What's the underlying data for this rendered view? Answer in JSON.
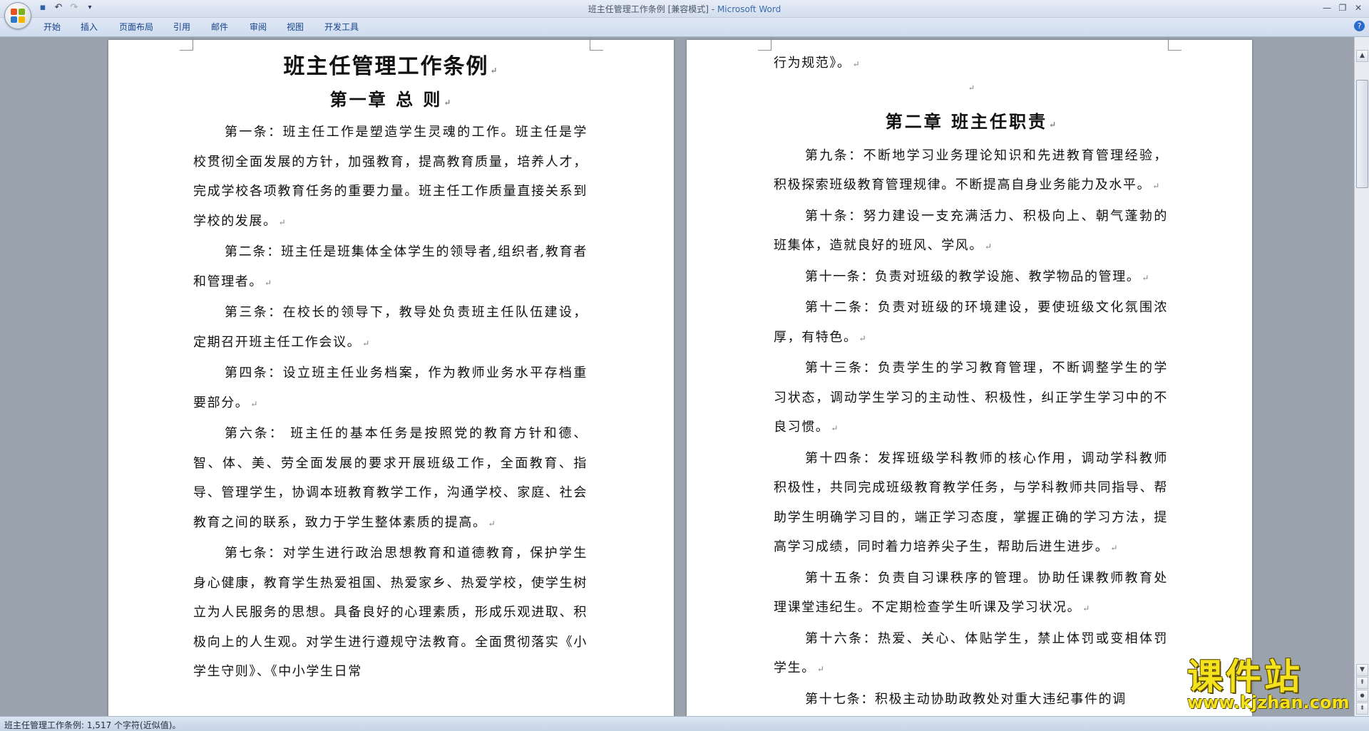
{
  "window": {
    "title_doc": "班主任管理工作条例 [兼容模式]",
    "title_sep": " - ",
    "title_app": "Microsoft Word"
  },
  "qat": {
    "save_icon": "▪",
    "undo_icon": "↶",
    "redo_icon": "↷",
    "more_icon": "▾"
  },
  "window_controls": {
    "minimize": "—",
    "restore": "❐",
    "close": "✕"
  },
  "ribbon_tabs": [
    "开始",
    "插入",
    "页面布局",
    "引用",
    "邮件",
    "审阅",
    "视图",
    "开发工具"
  ],
  "help_icon": "?",
  "para_mark": "↵",
  "page1": {
    "title": "班主任管理工作条例",
    "chapter": "第一章  总  则",
    "paragraphs": [
      "第一条：班主任工作是塑造学生灵魂的工作。班主任是学校贯彻全面发展的方针，加强教育，提高教育质量，培养人才，完成学校各项教育任务的重要力量。班主任工作质量直接关系到学校的发展。",
      "第二条：班主任是班集体全体学生的领导者,组织者,教育者和管理者。",
      "第三条：在校长的领导下，教导处负责班主任队伍建设，定期召开班主任工作会议。",
      "第四条：设立班主任业务档案，作为教师业务水平存档重要部分。",
      "第六条： 班主任的基本任务是按照党的教育方针和德、智、体、美、劳全面发展的要求开展班级工作，全面教育、指导、管理学生，协调本班教育教学工作，沟通学校、家庭、社会教育之间的联系，致力于学生整体素质的提高。",
      "第七条：对学生进行政治思想教育和道德教育，保护学生身心健康，教育学生热爱祖国、热爱家乡、热爱学校，使学生树立为人民服务的思想。具备良好的心理素质，形成乐观进取、积极向上的人生观。对学生进行遵规守法教育。全面贯彻落实《小学生守则》、《中小学生日常"
    ]
  },
  "page2": {
    "continuation": "行为规范》。",
    "chapter": "第二章    班主任职责",
    "paragraphs": [
      "第九条：不断地学习业务理论知识和先进教育管理经验，积极探索班级教育管理规律。不断提高自身业务能力及水平。",
      "第十条：努力建设一支充满活力、积极向上、朝气蓬勃的班集体，造就良好的班风、学风。",
      "第十一条：负责对班级的教学设施、教学物品的管理。",
      "第十二条：负责对班级的环境建设，要使班级文化氛围浓厚，有特色。",
      "第十三条：负责学生的学习教育管理，不断调整学生的学习状态，调动学生学习的主动性、积极性，纠正学生学习中的不良习惯。",
      "第十四条：发挥班级学科教师的核心作用，调动学科教师积极性，共同完成班级教育教学任务，与学科教师共同指导、帮助学生明确学习目的，端正学习态度，掌握正确的学习方法，提高学习成绩，同时着力培养尖子生，帮助后进生进步。",
      "第十五条：负责自习课秩序的管理。协助任课教师教育处理课堂违纪生。不定期检查学生听课及学习状况。",
      "第十六条：热爱、关心、体贴学生，禁止体罚或变相体罚学生。",
      "第十七条：积极主动协助政教处对重大违纪事件的调"
    ]
  },
  "statusbar": {
    "text": "班主任管理工作条例: 1,517 个字符(近似值)。"
  },
  "watermark": {
    "main": "课件站",
    "url": "www.kjzhan.com"
  },
  "scrollbar": {
    "up_icon": "▲",
    "down_icon": "▼",
    "prev_page_icon": "⇞",
    "browse_icon": "●",
    "next_page_icon": "⇟"
  },
  "colors": {
    "accent": "#15428b",
    "watermark": "#f4e21c",
    "app_title": "#3a6bb0"
  }
}
